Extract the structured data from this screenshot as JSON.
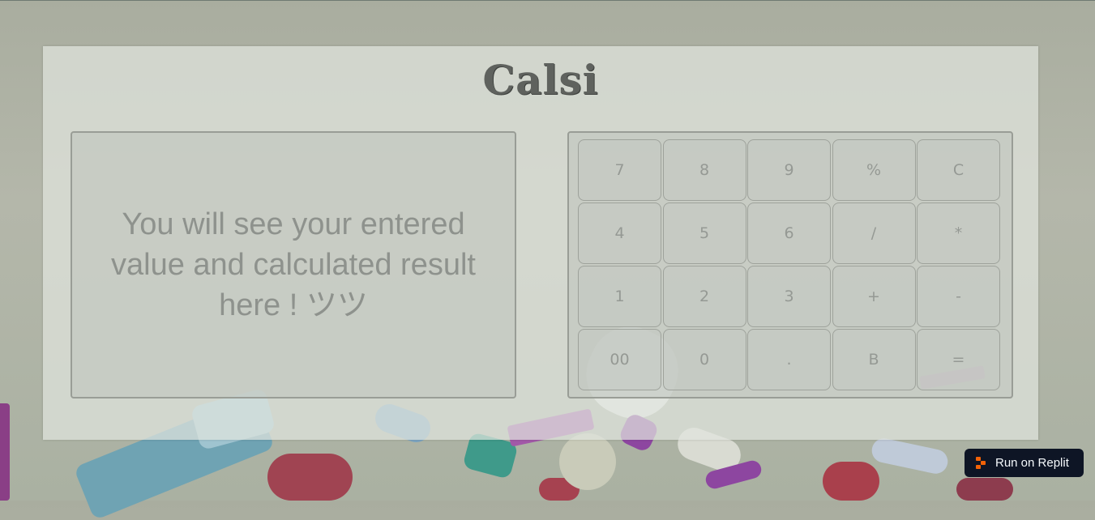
{
  "app": {
    "title": "Calsi"
  },
  "display": {
    "placeholder_text": "You will see your entered value and calculated result here ! ツツ"
  },
  "keypad": {
    "keys": [
      {
        "label": "7",
        "name": "key-7"
      },
      {
        "label": "8",
        "name": "key-8"
      },
      {
        "label": "9",
        "name": "key-9"
      },
      {
        "label": "%",
        "name": "key-percent"
      },
      {
        "label": "C",
        "name": "key-clear"
      },
      {
        "label": "4",
        "name": "key-4"
      },
      {
        "label": "5",
        "name": "key-5"
      },
      {
        "label": "6",
        "name": "key-6"
      },
      {
        "label": "/",
        "name": "key-divide"
      },
      {
        "label": "*",
        "name": "key-multiply"
      },
      {
        "label": "1",
        "name": "key-1"
      },
      {
        "label": "2",
        "name": "key-2"
      },
      {
        "label": "3",
        "name": "key-3"
      },
      {
        "label": "+",
        "name": "key-plus"
      },
      {
        "label": "-",
        "name": "key-minus"
      },
      {
        "label": "00",
        "name": "key-double-zero"
      },
      {
        "label": "0",
        "name": "key-0"
      },
      {
        "label": ".",
        "name": "key-decimal"
      },
      {
        "label": "B",
        "name": "key-backspace"
      },
      {
        "label": "=",
        "name": "key-equals"
      }
    ]
  },
  "replit_badge": {
    "label": "Run on Replit",
    "icon": "replit-logo-icon",
    "accent_color": "#f26207",
    "background_color": "#0e1525"
  }
}
